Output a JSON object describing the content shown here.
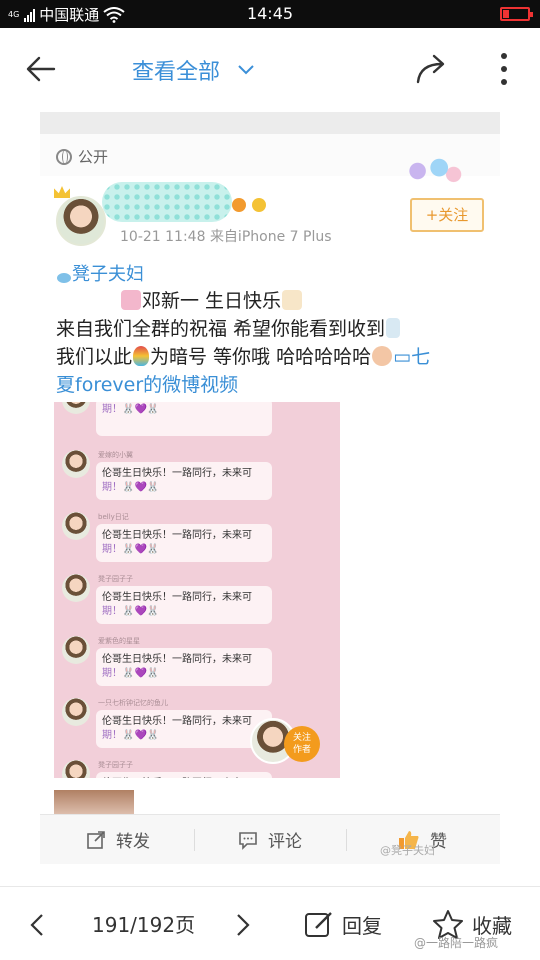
{
  "status": {
    "network": "4G",
    "carrier": "中国联通",
    "time": "14:45",
    "battery_level": 0.25
  },
  "nav": {
    "title": "查看全部",
    "icons": [
      "back-arrow-icon",
      "chevron-down-icon",
      "share-icon",
      "more-icon"
    ]
  },
  "post": {
    "visibility": "公开",
    "time": "10-21 11:48",
    "source": "来自iPhone 7 Plus",
    "follow_label": "+关注",
    "topic": "凳子夫妇",
    "line1": "邓新一 生日快乐",
    "line2": "来自我们全群的祝福 希望你能看到收到",
    "line3_a": "我们以此",
    "line3_b": "为暗号 等你哦 哈哈哈哈哈",
    "line3_link": "七",
    "line4_link": "夏forever的微博视频"
  },
  "video": {
    "messages": [
      {
        "nick": "",
        "text_a": "",
        "text_b": "期！🐰💜🐰"
      },
      {
        "nick": "爱嫁的小翼",
        "text_a": "伦哥生日快乐！一路同行，未来可",
        "text_b": "期！🐰💜🐰"
      },
      {
        "nick": "belly日记",
        "text_a": "伦哥生日快乐！一路同行，未来可",
        "text_b": "期！🐰💜🐰"
      },
      {
        "nick": "凳子园子子",
        "text_a": "伦哥生日快乐！一路同行，未来可",
        "text_b": "期！🐰💜🐰"
      },
      {
        "nick": "爱紫色的星星",
        "text_a": "伦哥生日快乐！一路同行，未来可",
        "text_b": "期！🐰💜🐰"
      },
      {
        "nick": "一只七析钟记忆的鱼儿",
        "text_a": "伦哥生日快乐！一路同行，未来可",
        "text_b": "期！🐰💜🐰"
      },
      {
        "nick": "凳子园子子",
        "text_a": "伦哥生日快乐！一路同行，未来可",
        "text_b": ""
      }
    ],
    "follow_author_label_1": "关注",
    "follow_author_label_2": "作者"
  },
  "actions": {
    "repost": "转发",
    "comment": "评论",
    "like": "赞",
    "watermark": "@凳子夫妇"
  },
  "bottom": {
    "page": "191/192页",
    "reply": "回复",
    "favorite": "收藏",
    "watermark": "@一路陪一路疯"
  },
  "colors": {
    "accent": "#3b8fd8",
    "follow": "#e8982e",
    "video_bg": "#f2cfd9"
  }
}
